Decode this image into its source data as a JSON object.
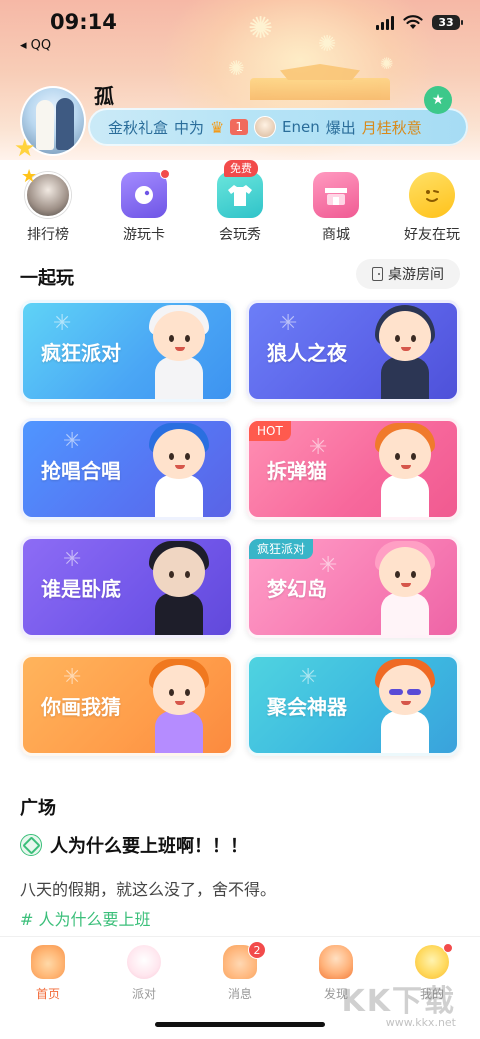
{
  "status": {
    "time": "09:14",
    "back_app": "◂ QQ",
    "battery": "33"
  },
  "profile": {
    "username": "孤"
  },
  "banner": {
    "prefix": "金秋礼盒",
    "mid": "中为",
    "rank": "1",
    "user": "Enen",
    "verb": "爆出",
    "item": "月桂秋意"
  },
  "quick_actions": [
    {
      "label": "排行榜",
      "icon": "leaderboard-avatar-icon"
    },
    {
      "label": "游玩卡",
      "icon": "game-card-icon"
    },
    {
      "label": "会玩秀",
      "icon": "outfit-show-icon",
      "badge": "免费"
    },
    {
      "label": "商城",
      "icon": "shop-icon"
    },
    {
      "label": "好友在玩",
      "icon": "friends-playing-icon"
    }
  ],
  "play_section": {
    "title": "一起玩",
    "room_button": "桌游房间"
  },
  "games": [
    {
      "title": "疯狂派对",
      "theme": "#4aa6f5"
    },
    {
      "title": "狼人之夜",
      "theme": "#5b62e8"
    },
    {
      "title": "抢唱合唱",
      "theme": "#5675f3"
    },
    {
      "title": "拆弹猫",
      "theme": "#f7689c",
      "tag": "HOT"
    },
    {
      "title": "谁是卧底",
      "theme": "#7156e9"
    },
    {
      "title": "梦幻岛",
      "theme": "#f77bb3",
      "tag": "疯狂派对"
    },
    {
      "title": "你画我猜",
      "theme": "#ff9d4a"
    },
    {
      "title": "聚会神器",
      "theme": "#3cb8e0"
    }
  ],
  "plaza": {
    "title": "广场",
    "post_title": "人为什么要上班啊！！！",
    "post_body": "八天的假期，就这么没了，舍不得。",
    "post_tag": "# 人为什么要上班"
  },
  "tabs": [
    {
      "label": "首页",
      "active": true
    },
    {
      "label": "派对"
    },
    {
      "label": "消息",
      "badge": "2"
    },
    {
      "label": "发现"
    },
    {
      "label": "我的"
    }
  ],
  "watermark": {
    "text": "KK下载",
    "url": "www.kkx.net"
  }
}
